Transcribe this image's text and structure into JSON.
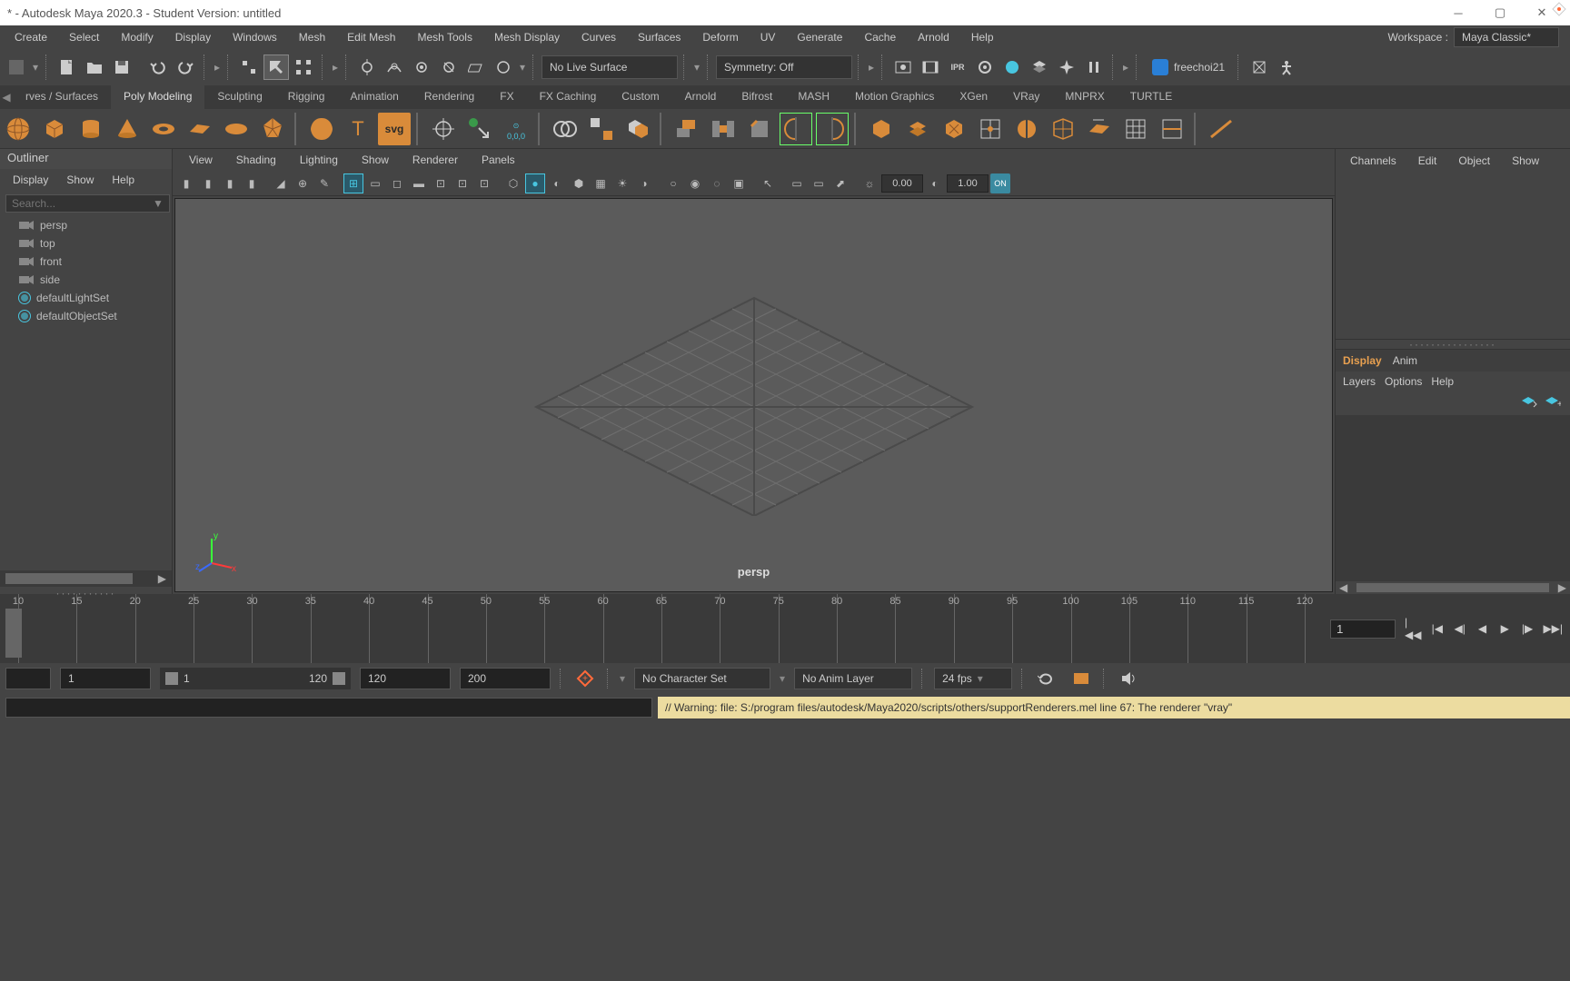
{
  "title": "* - Autodesk Maya 2020.3 - Student Version: untitled",
  "workspace": {
    "label": "Workspace :",
    "value": "Maya Classic*"
  },
  "menu": [
    "Create",
    "Select",
    "Modify",
    "Display",
    "Windows",
    "Mesh",
    "Edit Mesh",
    "Mesh Tools",
    "Mesh Display",
    "Curves",
    "Surfaces",
    "Deform",
    "UV",
    "Generate",
    "Cache",
    "Arnold",
    "Help"
  ],
  "toolbar": {
    "live": "No Live Surface",
    "symmetry": "Symmetry: Off",
    "user": "freechoi21"
  },
  "shelftabs": [
    "rves / Surfaces",
    "Poly Modeling",
    "Sculpting",
    "Rigging",
    "Animation",
    "Rendering",
    "FX",
    "FX Caching",
    "Custom",
    "Arnold",
    "Bifrost",
    "MASH",
    "Motion Graphics",
    "XGen",
    "VRay",
    "MNPRX",
    "TURTLE"
  ],
  "shelf_svg_label": "svg",
  "shelf_origin_label": "0,0,0",
  "outliner": {
    "title": "Outliner",
    "menu": [
      "Display",
      "Show",
      "Help"
    ],
    "search_ph": "Search...",
    "items": [
      {
        "icon": "camera",
        "label": "persp"
      },
      {
        "icon": "camera",
        "label": "top"
      },
      {
        "icon": "camera",
        "label": "front"
      },
      {
        "icon": "camera",
        "label": "side"
      },
      {
        "icon": "set",
        "label": "defaultLightSet"
      },
      {
        "icon": "set",
        "label": "defaultObjectSet"
      }
    ]
  },
  "viewport": {
    "menu": [
      "View",
      "Shading",
      "Lighting",
      "Show",
      "Renderer",
      "Panels"
    ],
    "exposure": "0.00",
    "gamma": "1.00",
    "on": "ON",
    "camera": "persp",
    "axis": {
      "x": "x",
      "y": "y",
      "z": "z"
    }
  },
  "channelbox": {
    "tabs": [
      "Channels",
      "Edit",
      "Object",
      "Show"
    ],
    "layertabs": [
      "Display",
      "Anim"
    ],
    "layermenu": [
      "Layers",
      "Options",
      "Help"
    ]
  },
  "timeslider": {
    "ticks": [
      "10",
      "15",
      "20",
      "25",
      "30",
      "35",
      "40",
      "45",
      "50",
      "55",
      "60",
      "65",
      "70",
      "75",
      "80",
      "85",
      "90",
      "95",
      "100",
      "105",
      "110",
      "115",
      "120"
    ],
    "current": "1"
  },
  "range": {
    "startvis": "1",
    "startrange": "1",
    "endvis": "120",
    "endrange": "120",
    "endtotal": "200",
    "charset": "No Character Set",
    "animlayer": "No Anim Layer",
    "fps": "24 fps"
  },
  "status": "// Warning: file: S:/program files/autodesk/Maya2020/scripts/others/supportRenderers.mel line 67: The renderer \"vray\""
}
